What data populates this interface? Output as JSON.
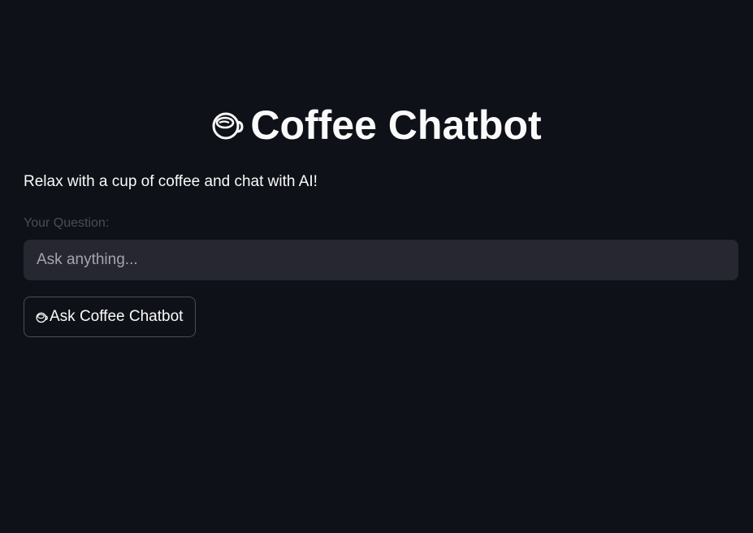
{
  "app": {
    "title": "Coffee Chatbot",
    "title_icon": "coffee-cup-icon",
    "subtitle": "Relax with a cup of coffee and chat with AI!"
  },
  "question": {
    "label": "Your Question:",
    "placeholder": "Ask anything...",
    "value": ""
  },
  "ask_button": {
    "icon": "coffee-cup-icon",
    "label": "Ask Coffee Chatbot"
  },
  "colors": {
    "background": "#0e1117",
    "input_background": "#262730",
    "text": "#fafafa",
    "muted_label": "#4a4d55",
    "button_border": "#4b4e57"
  }
}
